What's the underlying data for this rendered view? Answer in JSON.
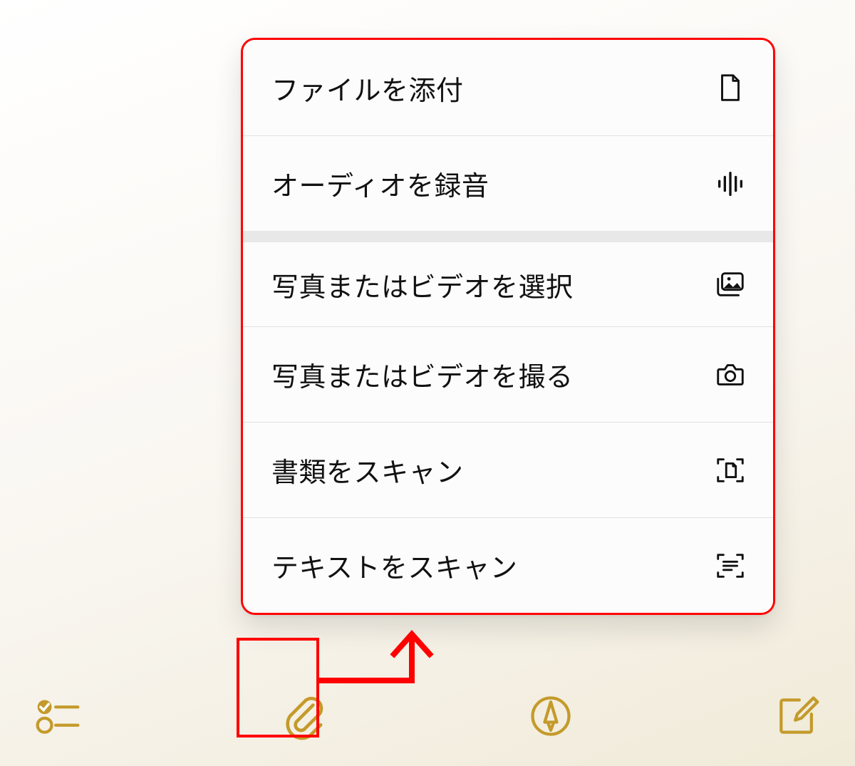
{
  "menu": {
    "items": [
      {
        "label": "ファイルを添付",
        "icon": "document-icon"
      },
      {
        "label": "オーディオを録音",
        "icon": "waveform-icon"
      },
      {
        "label": "写真またはビデオを選択",
        "icon": "photos-icon"
      },
      {
        "label": "写真またはビデオを撮る",
        "icon": "camera-icon"
      },
      {
        "label": "書類をスキャン",
        "icon": "scan-document-icon"
      },
      {
        "label": "テキストをスキャン",
        "icon": "scan-text-icon"
      }
    ]
  },
  "toolbar": {
    "accent_color": "#c49a2a"
  },
  "annotation": {
    "highlight_color": "#ff0000"
  }
}
